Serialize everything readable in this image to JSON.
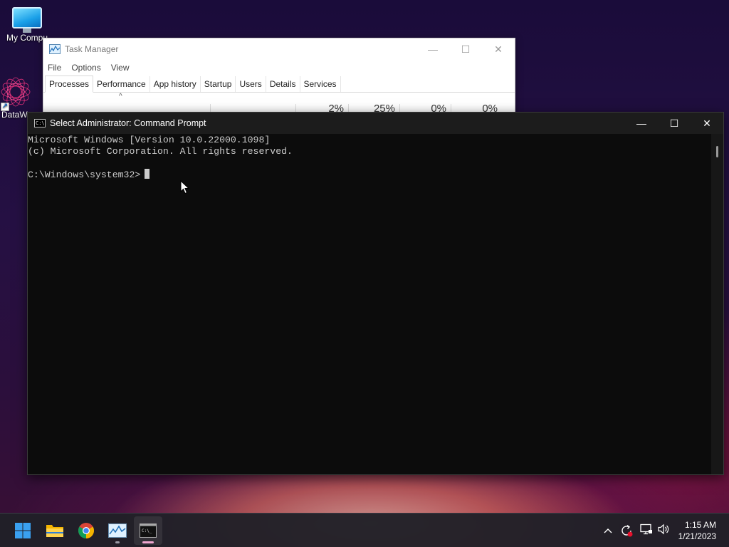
{
  "desktop": {
    "icons": [
      {
        "label": "My Compu"
      },
      {
        "label": "DataW"
      }
    ]
  },
  "task_manager": {
    "title": "Task Manager",
    "caption": {
      "minimize": "—",
      "maximize": "☐",
      "close": "✕"
    },
    "menu": [
      "File",
      "Options",
      "View"
    ],
    "tabs": [
      "Processes",
      "Performance",
      "App history",
      "Startup",
      "Users",
      "Details",
      "Services"
    ],
    "active_tab": "Processes",
    "sort_glyph": "^",
    "column_percents": [
      "2%",
      "25%",
      "0%",
      "0%"
    ]
  },
  "cmd": {
    "title": "Select Administrator:  Command Prompt",
    "caption": {
      "minimize": "—",
      "maximize": "☐",
      "close": "✕"
    },
    "lines": [
      "Microsoft Windows [Version 10.0.22000.1098]",
      "(c) Microsoft Corporation. All rights reserved.",
      "",
      "C:\\Windows\\system32>"
    ]
  },
  "taskbar": {
    "pinned": [
      "start-icon",
      "file-explorer-icon",
      "chrome-icon",
      "task-manager-icon",
      "command-prompt-icon"
    ],
    "tray_overflow": "^",
    "clock": {
      "time": "1:15 AM",
      "date": "1/21/2023"
    },
    "indicator_colors": {
      "task_manager": "#9a9aa5",
      "cmd": "#f0a6d0"
    }
  }
}
